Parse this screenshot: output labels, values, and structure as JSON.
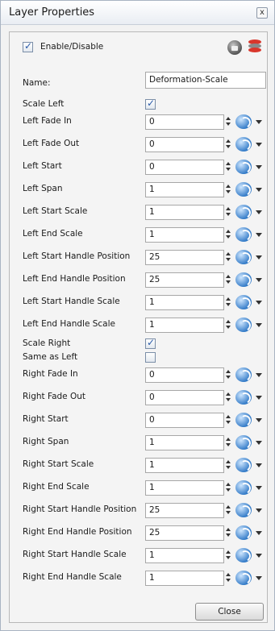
{
  "window": {
    "title": "Layer Properties",
    "close_glyph": "x"
  },
  "enable": {
    "label": "Enable/Disable",
    "checked": true
  },
  "icons": {
    "lock": "lock-icon",
    "database": "database-icon",
    "function": "function-curve-icon"
  },
  "name": {
    "label": "Name:",
    "value": "Deformation-Scale"
  },
  "rows": [
    {
      "label": "Scale Left",
      "type": "checkbox",
      "checked": true
    },
    {
      "label": "Left Fade In",
      "type": "field",
      "value": "0"
    },
    {
      "label": "Left Fade Out",
      "type": "field",
      "value": "0"
    },
    {
      "label": "Left Start",
      "type": "field",
      "value": "0"
    },
    {
      "label": "Left Span",
      "type": "field",
      "value": "1"
    },
    {
      "label": "Left Start Scale",
      "type": "field",
      "value": "1"
    },
    {
      "label": "Left End Scale",
      "type": "field",
      "value": "1"
    },
    {
      "label": "Left Start Handle Position",
      "type": "field",
      "value": "25"
    },
    {
      "label": "Left End Handle Position",
      "type": "field",
      "value": "25"
    },
    {
      "label": "Left Start Handle Scale",
      "type": "field",
      "value": "1"
    },
    {
      "label": "Left End Handle Scale",
      "type": "field",
      "value": "1"
    },
    {
      "label": "Scale Right",
      "type": "checkbox",
      "checked": true
    },
    {
      "label": "Same as Left",
      "type": "checkbox",
      "checked": false
    },
    {
      "label": "Right Fade In",
      "type": "field",
      "value": "0"
    },
    {
      "label": "Right Fade Out",
      "type": "field",
      "value": "0"
    },
    {
      "label": "Right Start",
      "type": "field",
      "value": "0"
    },
    {
      "label": "Right Span",
      "type": "field",
      "value": "1"
    },
    {
      "label": "Right Start Scale",
      "type": "field",
      "value": "1"
    },
    {
      "label": "Right End Scale",
      "type": "field",
      "value": "1"
    },
    {
      "label": "Right Start Handle Position",
      "type": "field",
      "value": "25"
    },
    {
      "label": "Right End Handle Position",
      "type": "field",
      "value": "25"
    },
    {
      "label": "Right Start Handle Scale",
      "type": "field",
      "value": "1"
    },
    {
      "label": "Right End Handle Scale",
      "type": "field",
      "value": "1"
    }
  ],
  "buttons": {
    "close_label": "Close"
  },
  "colors": {
    "accent": "#2f78c6",
    "db_red": "#d9372c",
    "db_gray": "#8a8a8a"
  }
}
